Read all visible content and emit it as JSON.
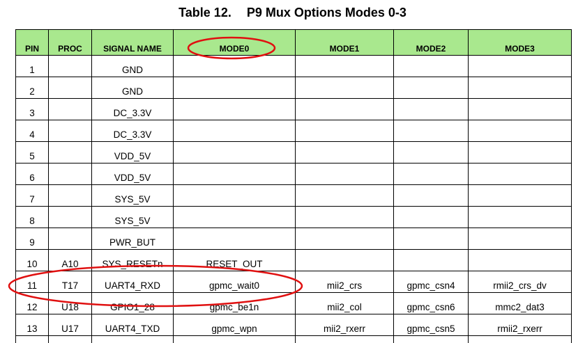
{
  "title": {
    "label": "Table 12.",
    "text": "P9  Mux Options Modes 0-3"
  },
  "header_color": "#a9e88e",
  "annotation_color": "#e01010",
  "columns": [
    "PIN",
    "PROC",
    "SIGNAL NAME",
    "MODE0",
    "MODE1",
    "MODE2",
    "MODE3"
  ],
  "rows": [
    {
      "pin": "1",
      "proc": "",
      "signal": "GND",
      "mode0": "",
      "mode1": "",
      "mode2": "",
      "mode3": ""
    },
    {
      "pin": "2",
      "proc": "",
      "signal": "GND",
      "mode0": "",
      "mode1": "",
      "mode2": "",
      "mode3": ""
    },
    {
      "pin": "3",
      "proc": "",
      "signal": "DC_3.3V",
      "mode0": "",
      "mode1": "",
      "mode2": "",
      "mode3": ""
    },
    {
      "pin": "4",
      "proc": "",
      "signal": "DC_3.3V",
      "mode0": "",
      "mode1": "",
      "mode2": "",
      "mode3": ""
    },
    {
      "pin": "5",
      "proc": "",
      "signal": "VDD_5V",
      "mode0": "",
      "mode1": "",
      "mode2": "",
      "mode3": ""
    },
    {
      "pin": "6",
      "proc": "",
      "signal": "VDD_5V",
      "mode0": "",
      "mode1": "",
      "mode2": "",
      "mode3": ""
    },
    {
      "pin": "7",
      "proc": "",
      "signal": "SYS_5V",
      "mode0": "",
      "mode1": "",
      "mode2": "",
      "mode3": ""
    },
    {
      "pin": "8",
      "proc": "",
      "signal": "SYS_5V",
      "mode0": "",
      "mode1": "",
      "mode2": "",
      "mode3": ""
    },
    {
      "pin": "9",
      "proc": "",
      "signal": "PWR_BUT",
      "mode0": "",
      "mode1": "",
      "mode2": "",
      "mode3": ""
    },
    {
      "pin": "10",
      "proc": "A10",
      "signal": "SYS_RESETn",
      "mode0": "RESET_OUT",
      "mode1": "",
      "mode2": "",
      "mode3": ""
    },
    {
      "pin": "11",
      "proc": "T17",
      "signal": "UART4_RXD",
      "mode0": "gpmc_wait0",
      "mode1": "mii2_crs",
      "mode2": "gpmc_csn4",
      "mode3": "rmii2_crs_dv"
    },
    {
      "pin": "12",
      "proc": "U18",
      "signal": "GPIO1_28",
      "mode0": "gpmc_be1n",
      "mode1": "mii2_col",
      "mode2": "gpmc_csn6",
      "mode3": "mmc2_dat3"
    },
    {
      "pin": "13",
      "proc": "U17",
      "signal": "UART4_TXD",
      "mode0": "gpmc_wpn",
      "mode1": "mii2_rxerr",
      "mode2": "gpmc_csn5",
      "mode3": "rmii2_rxerr"
    }
  ]
}
